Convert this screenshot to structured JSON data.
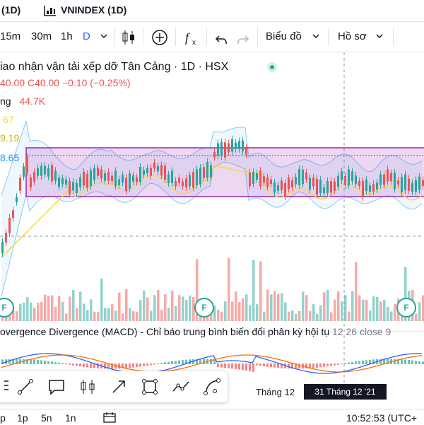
{
  "topbar": {
    "ticker_partial": "(1D)",
    "compare_label": "VNINDEX (1D)"
  },
  "toolbar": {
    "intervals": [
      "15m",
      "30m",
      "1h",
      "D"
    ],
    "active_interval": "D",
    "chart_type_label": "Biểu đồ",
    "profile_label": "Hồ sơ"
  },
  "legend": {
    "symbol_title": "iao nhận vận tải xếp dỡ Tân Cảng · 1D · HSX",
    "ohlc_prefix": "40.00",
    "close_label": "C40.00",
    "change": "−0.10 (−0.25%)",
    "volume_label": "ng",
    "volume_value": "44.7K",
    "ma1_value": "67",
    "ma2_value": "9.19",
    "bb_value": "8.65"
  },
  "colors": {
    "up": "#26a69a",
    "down": "#ef5350",
    "band": "#9c27b0",
    "bb_line": "#2196f3",
    "ma_yellow": "#f7d93f",
    "macd_blue": "#2962ff",
    "signal_orange": "#ff6d00"
  },
  "macd": {
    "title": "overgence Divergence (MACD) - Chỉ báo trung bình biến đổi phân kỳ hội tụ",
    "params": "12 26 close 9"
  },
  "earnings_marker": "F",
  "time_axis": {
    "month_label": "Tháng 12",
    "crosshair_label": "31 Tháng 12 '21"
  },
  "bottombar": {
    "ranges": [
      "p",
      "1p",
      "5n",
      "1n"
    ],
    "clock": "10:52:53 (UTC+"
  },
  "chart_data": {
    "type": "candlestick",
    "y_range": [
      33,
      45
    ],
    "highlight_box": [
      40.5,
      39.8
    ]
  }
}
